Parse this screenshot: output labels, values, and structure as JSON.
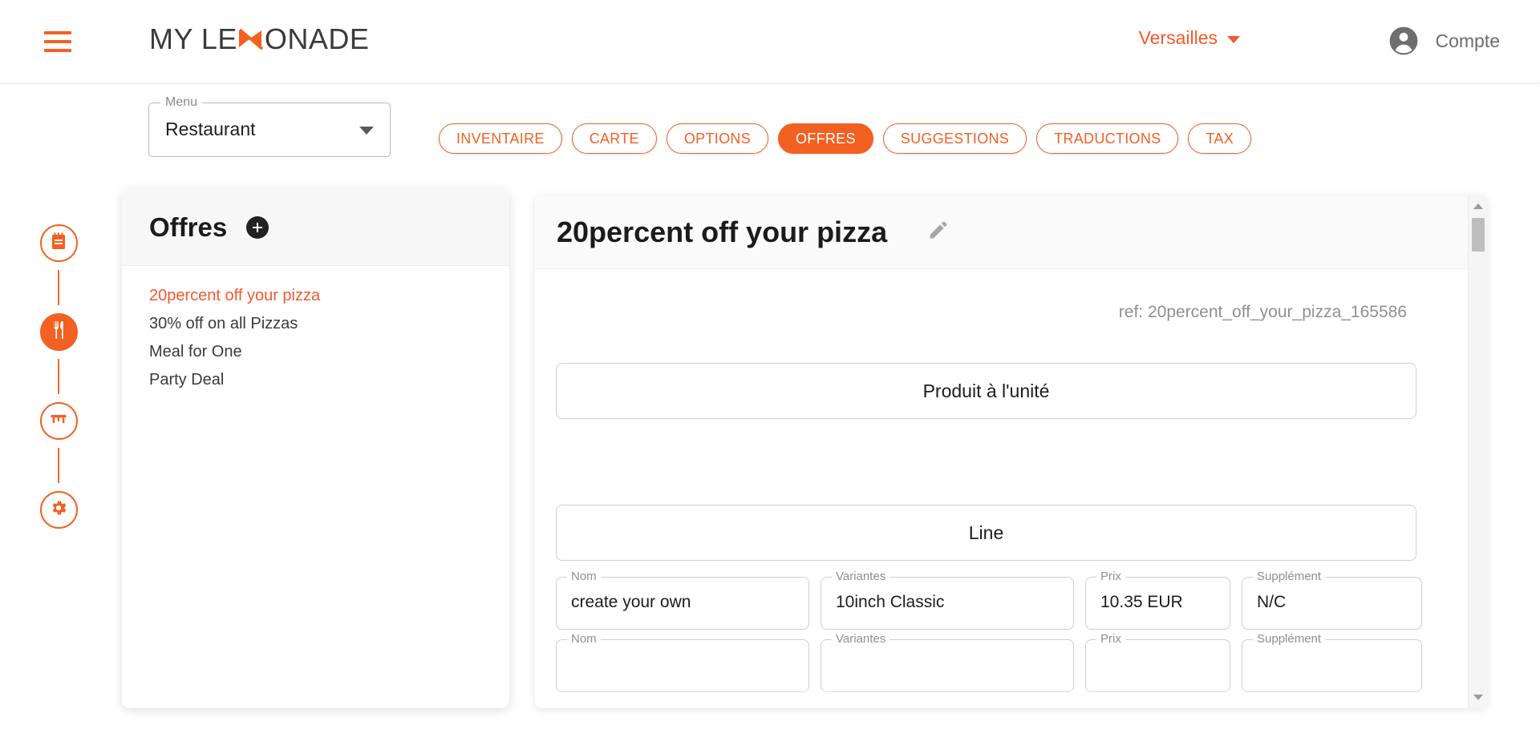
{
  "header": {
    "menu_icon": "hamburger-menu-icon",
    "logo_text_before": "MY LE",
    "logo_mark": "lemonade-m-mark",
    "logo_text_after": "ONADE",
    "location": "Versailles",
    "location_chevron": "chevron-down-icon",
    "account_icon": "account-circle-icon",
    "account_label": "Compte"
  },
  "menu_select": {
    "legend": "Menu",
    "value": "Restaurant",
    "arrow_icon": "dropdown-arrow-icon"
  },
  "tabs": [
    {
      "label": "INVENTAIRE",
      "active": false
    },
    {
      "label": "CARTE",
      "active": false
    },
    {
      "label": "OPTIONS",
      "active": false
    },
    {
      "label": "OFFRES",
      "active": true
    },
    {
      "label": "SUGGESTIONS",
      "active": false
    },
    {
      "label": "TRADUCTIONS",
      "active": false
    },
    {
      "label": "TAX",
      "active": false
    }
  ],
  "rail": [
    {
      "name": "orders-notepad-icon",
      "active": false
    },
    {
      "name": "restaurant-cutlery-icon",
      "active": true
    },
    {
      "name": "table-icon",
      "active": false
    },
    {
      "name": "settings-gear-icon",
      "active": false
    }
  ],
  "offers_panel": {
    "title": "Offres",
    "add_icon": "plus-icon",
    "items": [
      {
        "label": "20percent off your pizza",
        "selected": true
      },
      {
        "label": "30% off on all Pizzas",
        "selected": false
      },
      {
        "label": "Meal for One",
        "selected": false
      },
      {
        "label": "Party Deal",
        "selected": false
      }
    ]
  },
  "detail": {
    "title": "20percent off your pizza",
    "edit_icon": "pencil-edit-icon",
    "ref": "ref: 20percent_off_your_pizza_165586",
    "box_unit": "Produit à l'unité",
    "box_line": "Line",
    "rows": [
      {
        "nom_label": "Nom",
        "nom_value": "create your own",
        "variantes_label": "Variantes",
        "variantes_value": "10inch Classic",
        "prix_label": "Prix",
        "prix_value": "10.35 EUR",
        "supplement_label": "Supplément",
        "supplement_value": "N/C"
      },
      {
        "nom_label": "Nom",
        "nom_value": "",
        "variantes_label": "Variantes",
        "variantes_value": "",
        "prix_label": "Prix",
        "prix_value": "",
        "supplement_label": "Supplément",
        "supplement_value": ""
      }
    ],
    "scrollbar": {
      "up_icon": "scroll-up-arrow-icon",
      "down_icon": "scroll-down-arrow-icon"
    }
  },
  "colors": {
    "brand_orange": "#f26122",
    "accent_orange": "#f4592a",
    "text_dark": "#1b1b1b",
    "text_muted": "#8f8f8f"
  }
}
